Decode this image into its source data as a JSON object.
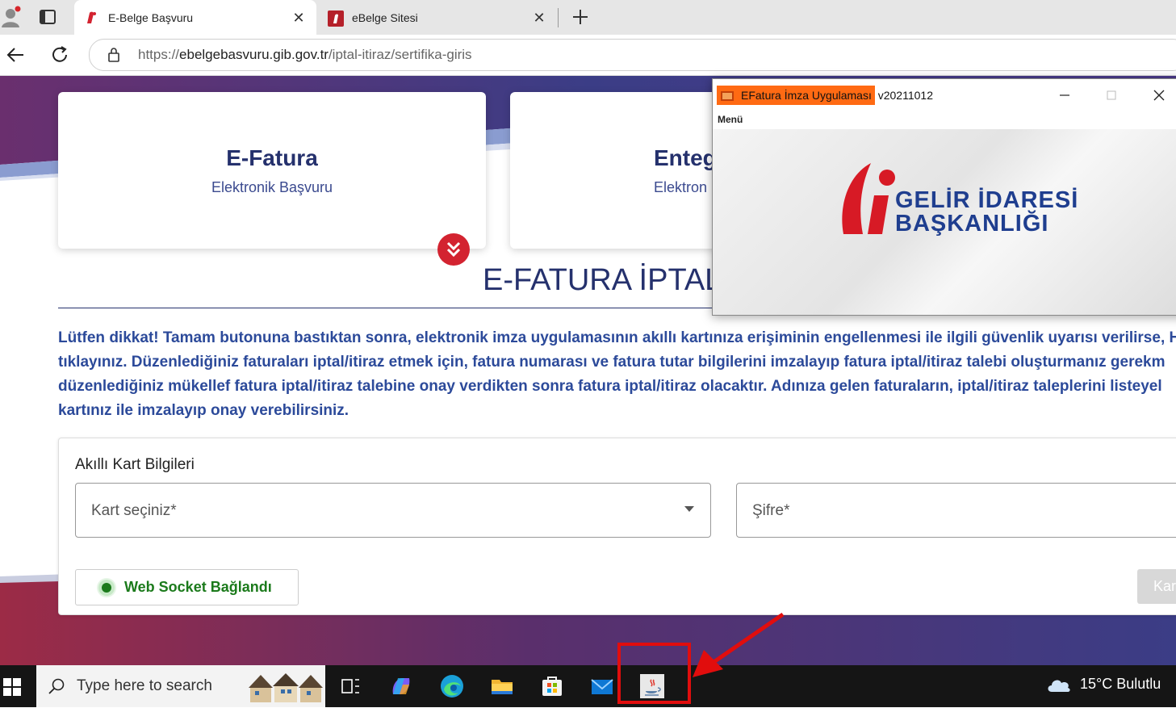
{
  "browser": {
    "tabs": [
      {
        "title": "E-Belge Başvuru",
        "active": true
      },
      {
        "title": "eBelge Sitesi",
        "active": false
      }
    ],
    "url": {
      "prefix": "https://",
      "host": "ebelgebasvuru.gib.gov.tr",
      "path": "/iptal-itiraz/sertifika-giris"
    }
  },
  "page": {
    "cards": [
      {
        "title": "E-Fatura",
        "subtitle": "Elektronik Başvuru"
      },
      {
        "title": "Enteg",
        "subtitle": "Elektron"
      }
    ],
    "heading": "E-FATURA İPTAL",
    "notice_lines": [
      "Lütfen dikkat! Tamam butonuna bastıktan sonra, elektronik imza uygulamasının akıllı kartınıza erişiminin engellenmesi ile ilgili güvenlik uyarısı verilirse, H",
      "tıklayınız. Düzenlediğiniz faturaları iptal/itiraz etmek için, fatura numarası ve fatura tutar bilgilerini imzalayıp fatura iptal/itiraz talebi oluşturmanız gerekm",
      "düzenlediğiniz mükellef fatura iptal/itiraz talebine onay verdikten sonra fatura iptal/itiraz olacaktır. Adınıza gelen faturaların, iptal/itiraz taleplerini listeyel",
      "kartınız ile imzalayıp onay verebilirsiniz."
    ],
    "form": {
      "title": "Akıllı Kart Bilgileri",
      "card_select_placeholder": "Kart seçiniz*",
      "password_placeholder": "Şifre*",
      "websocket_status": "Web Socket Bağlandı",
      "submit_label": "Kar"
    }
  },
  "java_window": {
    "title_highlighted": "EFatura İmza Uygulaması",
    "title_version": "v20211012",
    "menu": "Menü",
    "logo_line1": "GELİR İDARESİ",
    "logo_line2": "BAŞKANLIĞI"
  },
  "taskbar": {
    "search_placeholder": "Type here to search",
    "weather": "15°C  Bulutlu"
  },
  "colors": {
    "brand_blue": "#25316d",
    "brand_red": "#d32330",
    "highlight_orange": "#ff6a13",
    "annotation_red": "#e10d0d",
    "status_green": "#1b7a1b"
  }
}
